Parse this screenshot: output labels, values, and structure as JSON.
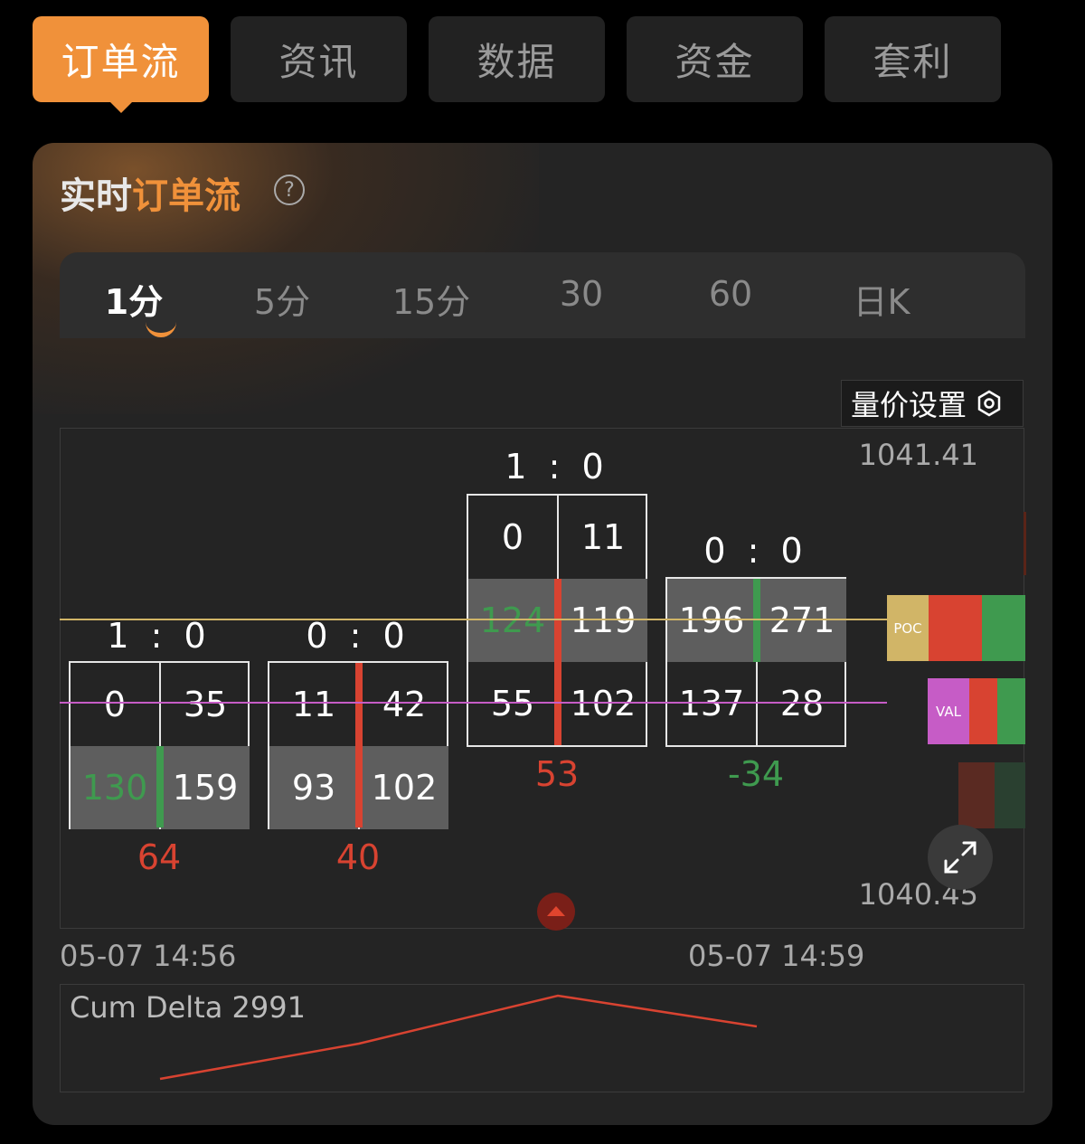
{
  "top_tabs": [
    "订单流",
    "资讯",
    "数据",
    "资金",
    "套利"
  ],
  "title": {
    "prefix": "实时",
    "highlight": "订单流",
    "help": "?"
  },
  "period_tabs": [
    "1分",
    "5分",
    "15分",
    "30",
    "60",
    "日K"
  ],
  "settings_label": "量价设置",
  "price_high": "1041.41",
  "price_low": "1040.45",
  "bars": [
    {
      "ratio": "1 : 0",
      "cells": [
        "0",
        "35",
        "130",
        "159"
      ],
      "delta": "64"
    },
    {
      "ratio": "0 : 0",
      "cells": [
        "11",
        "42",
        "93",
        "102"
      ],
      "delta": "40"
    },
    {
      "ratio": "1 : 0",
      "cells": [
        "0",
        "11",
        "124",
        "119",
        "55",
        "102"
      ],
      "delta": "53"
    },
    {
      "ratio": "0 : 0",
      "cells": [
        "196",
        "271",
        "137",
        "28"
      ],
      "delta": "-34"
    }
  ],
  "profile": {
    "poc_label": "POC",
    "val_label": "VAL"
  },
  "time_labels": [
    "05-07 14:56",
    "05-07 14:59"
  ],
  "cum_delta_label": "Cum Delta 2991",
  "colors": {
    "accent": "#f0913a",
    "buy_green": "#3f9a4f",
    "sell_red": "#d84331",
    "poc_gold": "#d1b567",
    "val_purple": "#c65cc6"
  }
}
